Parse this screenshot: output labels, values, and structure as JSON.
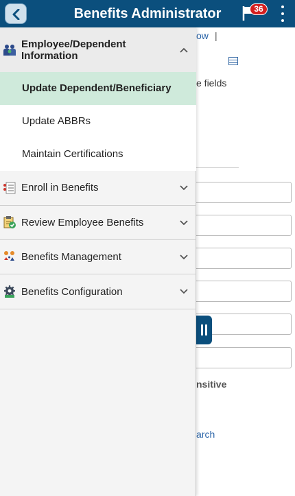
{
  "header": {
    "title": "Benefits Administrator",
    "notification_count": "36"
  },
  "background": {
    "link_fragment": "ow",
    "separator": "|",
    "fields_text": "e fields",
    "sensitive_text": "nsitive",
    "search_link": "arch"
  },
  "menu": {
    "sections": [
      {
        "label": "Employee/Dependent Information",
        "icon": "people-icon",
        "expanded": true,
        "items": [
          {
            "label": "Update Dependent/Beneficiary",
            "active": true
          },
          {
            "label": "Update ABBRs",
            "active": false
          },
          {
            "label": "Maintain Certifications",
            "active": false
          }
        ]
      },
      {
        "label": "Enroll in Benefits",
        "icon": "enroll-list-icon",
        "expanded": false
      },
      {
        "label": "Review Employee Benefits",
        "icon": "clipboard-check-icon",
        "expanded": false
      },
      {
        "label": "Benefits Management",
        "icon": "benefits-management-icon",
        "expanded": false
      },
      {
        "label": "Benefits Configuration",
        "icon": "gear-config-icon",
        "expanded": false
      }
    ]
  },
  "colors": {
    "header_bg": "#0b4f7d",
    "active_item_bg": "#cfeadb",
    "badge_bg": "#d51f1f",
    "link": "#2a64a8"
  }
}
